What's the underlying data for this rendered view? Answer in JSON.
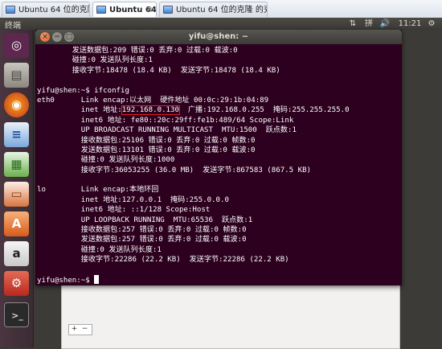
{
  "tabs": [
    {
      "label": "Ubuntu 64 位的克隆",
      "active": false
    },
    {
      "label": "Ubuntu 64",
      "active": true
    },
    {
      "label": "Ubuntu 64 位的克隆 的克隆",
      "active": false
    }
  ],
  "panel": {
    "title": "终端",
    "indicators": {
      "keyboard": "⇅",
      "sound": "🔊",
      "time": "11:21",
      "input_method": "拼",
      "power": "⚙"
    }
  },
  "launcher": [
    {
      "name": "dash",
      "icon": "ubuntu-logo-icon"
    },
    {
      "name": "files",
      "icon": "file-cabinet-icon"
    },
    {
      "name": "firefox",
      "icon": "firefox-icon"
    },
    {
      "name": "writer",
      "icon": "writer-document-icon"
    },
    {
      "name": "calc",
      "icon": "spreadsheet-icon"
    },
    {
      "name": "impress",
      "icon": "presentation-icon"
    },
    {
      "name": "software-center",
      "icon": "software-center-icon"
    },
    {
      "name": "amazon",
      "icon": "amazon-icon"
    },
    {
      "name": "settings",
      "icon": "settings-icon"
    },
    {
      "name": "terminal",
      "icon": "terminal-icon"
    }
  ],
  "terminal": {
    "title": "yifu@shen: ~",
    "lines": [
      "        发送数据包:209 错误:0 丢弃:0 过载:0 载波:0",
      "        碰撞:0 发送队列长度:1",
      "        接收字节:18478 (18.4 KB)  发送字节:18478 (18.4 KB)",
      "",
      "yifu@shen:~$ ifconfig",
      "eth0      Link encap:以太网  硬件地址 00:0c:29:1b:04:89",
      "          inet 地址:192.168.0.130  广播:192.168.0.255  掩码:255.255.255.0",
      "          inet6 地址: fe80::20c:29ff:fe1b:489/64 Scope:Link",
      "          UP BROADCAST RUNNING MULTICAST  MTU:1500  跃点数:1",
      "          接收数据包:25106 错误:0 丢弃:0 过载:0 帧数:0",
      "          发送数据包:13101 错误:0 丢弃:0 过载:0 载波:0",
      "          碰撞:0 发送队列长度:1000",
      "          接收字节:36053255 (36.0 MB)  发送字节:867583 (867.5 KB)",
      "",
      "lo        Link encap:本地环回",
      "          inet 地址:127.0.0.1  掩码:255.0.0.0",
      "          inet6 地址: ::1/128 Scope:Host",
      "          UP LOOPBACK RUNNING  MTU:65536  跃点数:1",
      "          接收数据包:257 错误:0 丢弃:0 过载:0 帧数:0",
      "          发送数据包:257 错误:0 丢弃:0 过载:0 载波:0",
      "          碰撞:0 发送队列长度:1",
      "          接收字节:22286 (22.2 KB)  发送字节:22286 (22.2 KB)",
      "",
      "yifu@shen:~$ "
    ],
    "highlight": {
      "line": 6,
      "text": "192.168.0.130"
    }
  },
  "background_window": {
    "add_label": "+",
    "remove_label": "−"
  }
}
